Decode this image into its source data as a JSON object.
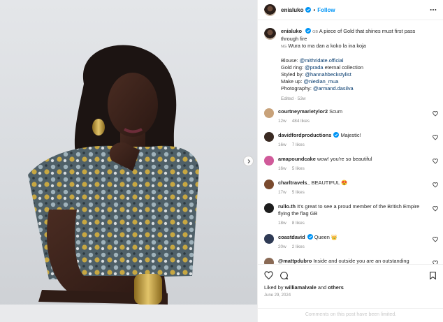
{
  "post": {
    "image_alt": "Portrait of woman in metallic sleeveless top with gold earrings and cuff"
  },
  "header": {
    "username": "enialuko",
    "separator": "•",
    "follow_label": "Follow"
  },
  "caption": {
    "username": "enialuko",
    "flag1": "GB",
    "line1": "A piece of Gold that shines must first pass through fire",
    "flag2": "NG",
    "line2": "Wura to ma dan a koko la ina koja",
    "credits": [
      {
        "label": "Blouse: ",
        "tag": "@mithridate.official",
        "suffix": ""
      },
      {
        "label": "Gold ring: ",
        "tag": "@prada",
        "suffix": " eternal collection"
      },
      {
        "label": "Styled by: ",
        "tag": "@hannahbeckstylist",
        "suffix": ""
      },
      {
        "label": "Make up: ",
        "tag": "@niedian_mua",
        "suffix": ""
      },
      {
        "label": "Photography: ",
        "tag": "@armand.dasilva",
        "suffix": ""
      }
    ],
    "edited": "Edited · 53w"
  },
  "comments": [
    {
      "user": "courtneymarietylor2",
      "text": "Scum",
      "time": "12w",
      "likes": "484 likes",
      "verified": false,
      "avatar_color": "#c8a27a"
    },
    {
      "user": "davidfordproductions",
      "text": "Majestic!",
      "time": "16w",
      "likes": "7 likes",
      "verified": true,
      "avatar_color": "#3a2a22"
    },
    {
      "user": "amapoundcake",
      "text": "wow! you're so beautiful",
      "time": "16w",
      "likes": "5 likes",
      "verified": false,
      "avatar_color": "#d05a9a"
    },
    {
      "user": "charltravels_",
      "text": "BEAUTIFUL 😍",
      "time": "17w",
      "likes": "5 likes",
      "verified": false,
      "avatar_color": "#7a4a2e"
    },
    {
      "user": "rullo.th",
      "text": "It's great to see a proud member of the British Empire flying the flag GB",
      "time": "18w",
      "likes": "8 likes",
      "verified": false,
      "avatar_color": "#1d1d1d"
    },
    {
      "user": "coastdavid",
      "text": "Queen 👑",
      "time": "20w",
      "likes": "2 likes",
      "verified": true,
      "avatar_color": "#2f3b55"
    },
    {
      "user": "@mattpdubro",
      "text": "Inside and outside you are an outstanding",
      "time": "",
      "likes": "",
      "verified": false,
      "avatar_color": "#8a6a55"
    }
  ],
  "actions": {
    "liked_by_prefix": "Liked by ",
    "liked_by_user": "williamalvale",
    "liked_by_suffix": " and ",
    "liked_by_others": "others",
    "date": "June 29, 2024",
    "comments_limited": "Comments on this post have been limited."
  },
  "colors": {
    "link": "#00376b",
    "follow": "#0095f6",
    "verified": "#0095f6",
    "muted": "#8e8e8e"
  },
  "icons": [
    "more-options-icon",
    "verified-badge-icon",
    "heart-icon",
    "comment-icon",
    "save-icon",
    "next-arrow-icon"
  ]
}
